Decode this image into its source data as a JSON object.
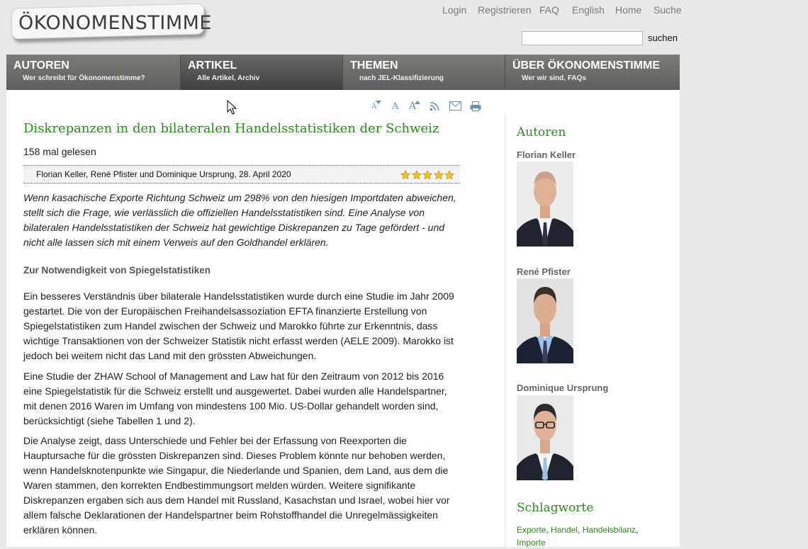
{
  "logo": {
    "text": "ÖKONOMENSTIMME"
  },
  "top_links": [
    "Login",
    "Registrieren",
    "FAQ",
    "English",
    "Home",
    "Suche"
  ],
  "search": {
    "placeholder": "",
    "button_label": "suchen"
  },
  "nav": [
    {
      "title": "AUTOREN",
      "subtitle": "Wer schreibt für Ökonomenstimme?"
    },
    {
      "title": "ARTIKEL",
      "subtitle": "Alle Artikel, Archiv"
    },
    {
      "title": "THEMEN",
      "subtitle": "nach JEL-Klassifizierung"
    },
    {
      "title": "ÜBER ÖKONOMENSTIMME",
      "subtitle": "Wer wir sind, FAQs"
    }
  ],
  "tools": {
    "font_smaller": "A",
    "font_normal": "A",
    "font_larger": "A",
    "icons": [
      "font-smaller-icon",
      "font-normal-icon",
      "font-larger-icon",
      "rss-icon",
      "email-icon",
      "print-icon"
    ]
  },
  "article": {
    "title": "Diskrepanzen in den bilateralen Handelsstatistiken der Schweiz",
    "reads": "158 mal gelesen",
    "byline": "Florian Keller, René Pfister und Dominique Ursprung, 28. April 2020",
    "rating": {
      "stars": 5,
      "max": 5
    },
    "lead": "Wenn kasachische Exporte Richtung Schweiz um 298% von den hiesigen Importdaten abweichen, stellt sich die Frage, wie verlässlich die offiziellen Handelsstatistiken sind. Eine Analyse von bilateralen Handelsstatistiken der Schweiz hat gewichtige Diskrepanzen zu Tage gefördert - und nicht alle lassen sich mit einem Verweis auf den Goldhandel erklären.",
    "section_heading": "Zur Notwendigkeit von Spiegelstatistiken",
    "paragraphs": [
      "Ein besseres Verständnis über bilaterale Handelsstatistiken wurde durch eine Studie im Jahr 2009 gestartet. Die von der Europäischen Freihandelsassoziation EFTA finanzierte Erstellung von Spiegelstatistiken zum Handel zwischen der Schweiz und Marokko führte zur Erkenntnis, dass wichtige Transaktionen von der Schweizer Statistik nicht erfasst werden (AELE 2009). Marokko ist jedoch bei weitem nicht das Land mit den grössten Abweichungen.",
      "Eine Studie der ZHAW School of Management and Law hat für den Zeitraum von 2012 bis 2016 eine Spiegelstatistik für die Schweiz erstellt und ausgewertet. Dabei wurden alle Handelspartner, mit denen 2016 Waren im Umfang von mindestens 100 Mio. US-Dollar gehandelt worden sind, berücksichtigt (siehe Tabellen 1 und 2).",
      "Die Analyse zeigt, dass Unterschiede und Fehler bei der Erfassung von Reexporten die Hauptursache für die grössten Diskrepanzen sind. Dieses Problem könnte nur behoben werden, wenn Handelsknotenpunkte wie Singapur, die Niederlande und Spanien, dem Land, aus dem die Waren stammen, den korrekten Endbestimmungsort melden würden. Weitere signifikante Diskrepanzen ergaben sich aus dem Handel mit Russland, Kasachstan und Israel, wobei hier vor allem falsche Deklarationen der Handelspartner beim Rohstoffhandel die Unregelmässigkeiten erklären können."
    ]
  },
  "sidebar": {
    "authors_heading": "Autoren",
    "authors": [
      {
        "name": "Florian Keller"
      },
      {
        "name": "René Pfister"
      },
      {
        "name": "Dominique Ursprung"
      }
    ],
    "tags_heading": "Schlagworte",
    "tags": [
      "Exporte",
      "Handel",
      "Handelsbilanz",
      "Importe"
    ]
  },
  "colors": {
    "accent_green": "#2a8a1c",
    "nav_gray": "#6b6b69",
    "link_gray": "#7a7a7a"
  }
}
